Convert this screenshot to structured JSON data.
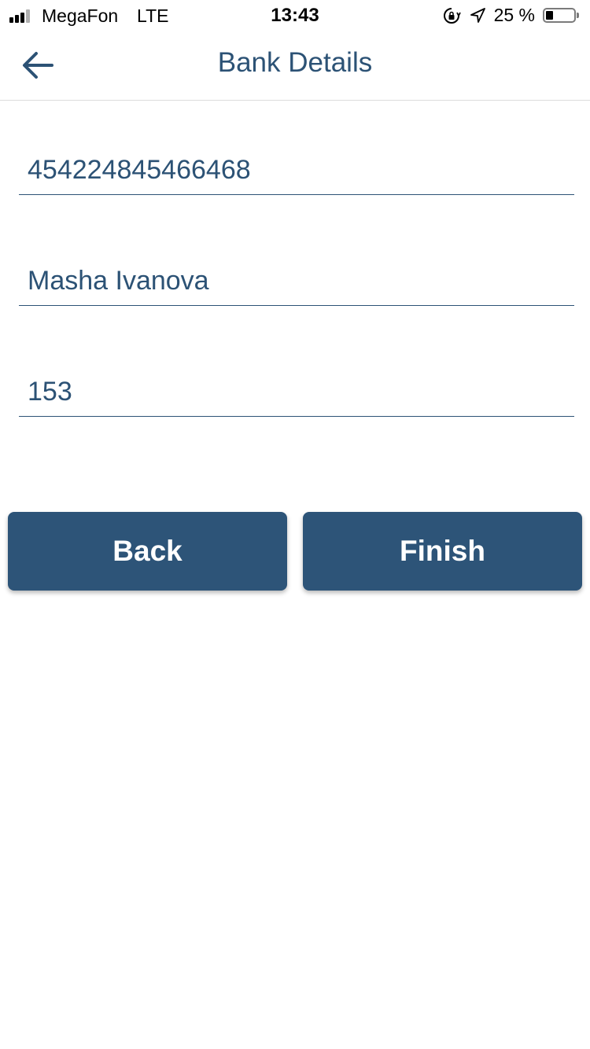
{
  "status_bar": {
    "carrier": "MegaFon",
    "network": "LTE",
    "time": "13:43",
    "battery_percent": "25 %",
    "battery_level": 0.25,
    "signal_bars": 3,
    "signal_bars_total": 4,
    "icons": [
      "orientation-lock-icon",
      "location-arrow-icon",
      "battery-icon"
    ]
  },
  "nav": {
    "title": "Bank Details",
    "back_icon": "arrow-left-icon"
  },
  "form": {
    "card_number": "454224845466468",
    "card_holder": "Masha Ivanova",
    "cvv": "153"
  },
  "buttons": {
    "back_label": "Back",
    "finish_label": "Finish"
  },
  "colors": {
    "primary": "#2d5478",
    "text": "#2c5275",
    "divider": "#dcdcdc"
  }
}
